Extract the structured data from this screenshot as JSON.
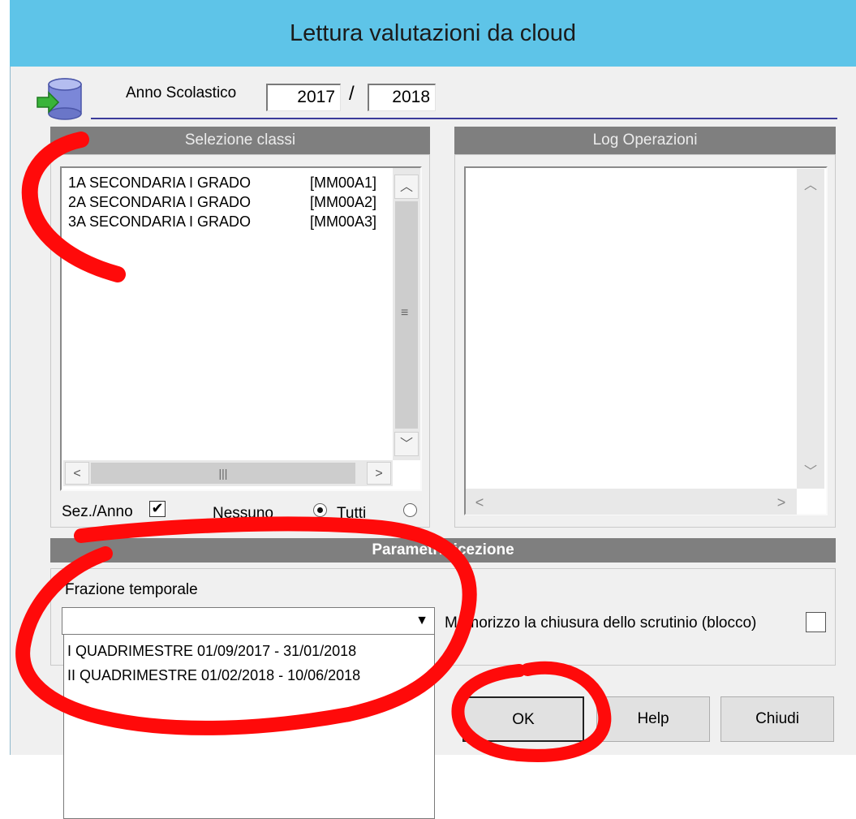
{
  "window": {
    "title": "Lettura valutazioni da cloud"
  },
  "header": {
    "anno_label": "Anno Scolastico",
    "year_start": "2017",
    "separator": "/",
    "year_end": "2018"
  },
  "classes": {
    "header": "Selezione classi",
    "items": [
      {
        "name": "1A SECONDARIA I GRADO",
        "code": "[MM00A1]"
      },
      {
        "name": "2A SECONDARIA I GRADO",
        "code": "[MM00A2]"
      },
      {
        "name": "3A SECONDARIA I GRADO",
        "code": "[MM00A3]"
      }
    ],
    "sez_label": "Sez./Anno",
    "sez_checked": "✔",
    "nessuno_label": "Nessuno",
    "tutti_label": "Tutti"
  },
  "log": {
    "header": "Log Operazioni"
  },
  "params": {
    "header": "Parametri ricezione",
    "frazione_label": "Frazione temporale",
    "frazione_value": "",
    "options": [
      "I QUADRIMESTRE 01/09/2017 - 31/01/2018",
      "II QUADRIMESTRE 01/02/2018 - 10/06/2018"
    ],
    "memorizzo_label": "Memorizzo la chiusura dello scrutinio (blocco)"
  },
  "buttons": {
    "ok": "OK",
    "help": "Help",
    "close": "Chiudi"
  },
  "colors": {
    "titlebar": "#5ec4e8",
    "panel_header": "#7f7f7f",
    "annotation": "#ff0000"
  }
}
